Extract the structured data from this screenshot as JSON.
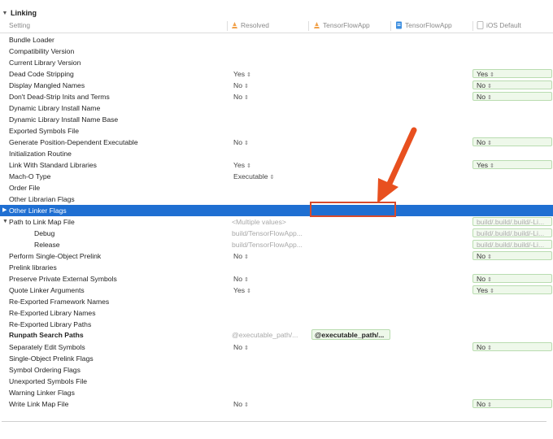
{
  "section": {
    "title": "Linking"
  },
  "columns": {
    "setting": "Setting",
    "resolved": "Resolved",
    "target1": "TensorFlowApp",
    "target2": "TensorFlowApp",
    "ios_default": "iOS Default"
  },
  "rows": [
    {
      "label": "Bundle Loader"
    },
    {
      "label": "Compatibility Version"
    },
    {
      "label": "Current Library Version"
    },
    {
      "label": "Dead Code Stripping",
      "resolved": "Yes",
      "default": "Yes"
    },
    {
      "label": "Display Mangled Names",
      "resolved": "No",
      "default": "No"
    },
    {
      "label": "Don't Dead-Strip Inits and Terms",
      "resolved": "No",
      "default": "No"
    },
    {
      "label": "Dynamic Library Install Name"
    },
    {
      "label": "Dynamic Library Install Name Base"
    },
    {
      "label": "Exported Symbols File"
    },
    {
      "label": "Generate Position-Dependent Executable",
      "resolved": "No",
      "default": "No"
    },
    {
      "label": "Initialization Routine"
    },
    {
      "label": "Link With Standard Libraries",
      "resolved": "Yes",
      "default": "Yes"
    },
    {
      "label": "Mach-O Type",
      "resolved": "Executable"
    },
    {
      "label": "Order File"
    },
    {
      "label": "Other Librarian Flags"
    },
    {
      "label": "Other Linker Flags"
    },
    {
      "label": "Path to Link Map File",
      "resolved": "<Multiple values>",
      "default": "build/.build/.build/-Li..."
    },
    {
      "label": "Debug",
      "resolved": "build/TensorFlowApp...",
      "default": "build/.build/.build/-Li..."
    },
    {
      "label": "Release",
      "resolved": "build/TensorFlowApp...",
      "default": "build/.build/.build/-Li..."
    },
    {
      "label": "Perform Single-Object Prelink",
      "resolved": "No",
      "default": "No"
    },
    {
      "label": "Prelink libraries"
    },
    {
      "label": "Preserve Private External Symbols",
      "resolved": "No",
      "default": "No"
    },
    {
      "label": "Quote Linker Arguments",
      "resolved": "Yes",
      "default": "Yes"
    },
    {
      "label": "Re-Exported Framework Names"
    },
    {
      "label": "Re-Exported Library Names"
    },
    {
      "label": "Re-Exported Library Paths"
    },
    {
      "label": "Runpath Search Paths",
      "resolved": "@executable_path/...",
      "target": "@executable_path/..."
    },
    {
      "label": "Separately Edit Symbols",
      "resolved": "No",
      "default": "No"
    },
    {
      "label": "Single-Object Prelink Flags"
    },
    {
      "label": "Symbol Ordering Flags"
    },
    {
      "label": "Unexported Symbols File"
    },
    {
      "label": "Warning Linker Flags"
    },
    {
      "label": "Write Link Map File",
      "resolved": "No",
      "default": "No"
    }
  ],
  "stepper_glyph": "⇕",
  "colors": {
    "selection": "#1f6fd2",
    "annotation": "#d94a2b",
    "default_bg": "#eef8ea"
  }
}
